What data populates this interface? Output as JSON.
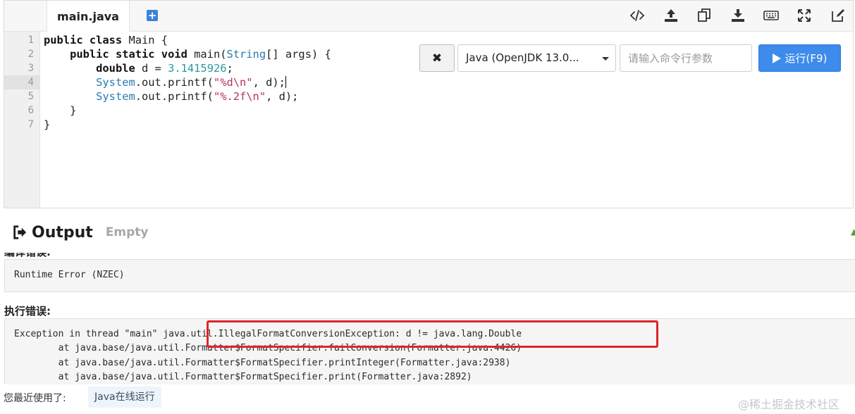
{
  "editor": {
    "tab_label": "main.java",
    "line_numbers": [
      "1",
      "2",
      "3",
      "4",
      "5",
      "6",
      "7"
    ],
    "code": {
      "l1_kw": "public class",
      "l1_rest": " Main {",
      "l2_kw": "public static void",
      "l2_a": " main(",
      "l2_type": "String",
      "l2_b": "[] args) {",
      "l3_kw": "double",
      "l3_a": " d = ",
      "l3_num": "3.1415926",
      "l3_b": ";",
      "l4_type": "System",
      "l4_a": ".out.printf(",
      "l4_str": "\"%d\\n\"",
      "l4_b": ", d);",
      "l5_type": "System",
      "l5_a": ".out.printf(",
      "l5_str": "\"%.2f\\n\"",
      "l5_b": ", d);",
      "l6": "}",
      "l7": "}"
    },
    "toolbar_icons": [
      "code-icon",
      "upload-icon",
      "copy-icon",
      "download-icon",
      "keyboard-icon",
      "fullscreen-icon",
      "edit-icon"
    ]
  },
  "controls": {
    "clear_symbol": "✖",
    "language_value": "Java (OpenJDK 13.0...",
    "args_placeholder": "请输入命令行参数",
    "run_label": "运行(F9)"
  },
  "output": {
    "title": "Output",
    "status": "Empty",
    "compile_label_cut": "编译错误:",
    "compile_text": "Runtime Error (NZEC)",
    "runtime_label": "执行错误:",
    "runtime_lines": [
      "Exception in thread \"main\" java.util.IllegalFormatConversionException: d != java.lang.Double",
      "        at java.base/java.util.Formatter$FormatSpecifier.failConversion(Formatter.java:4426)",
      "        at java.base/java.util.Formatter$FormatSpecifier.printInteger(Formatter.java:2938)",
      "        at java.base/java.util.Formatter$FormatSpecifier.print(Formatter.java:2892)"
    ]
  },
  "footer": {
    "recent_label": "您最近使用了:",
    "recent_tag": "Java在线运行",
    "watermark": "@稀土掘金技术社区"
  },
  "colors": {
    "run_button": "#3d8bea",
    "highlight_border": "#e0242a",
    "keyword_type": "#2a7ab0",
    "string": "#b5345a",
    "number": "#2a9aa0"
  }
}
